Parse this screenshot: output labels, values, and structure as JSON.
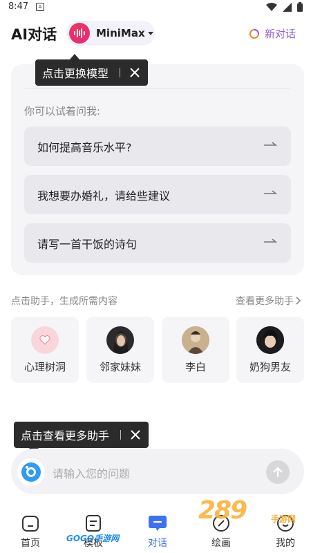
{
  "status_bar": {
    "time": "8:47",
    "notify_glyph": "A"
  },
  "header": {
    "title": "AI对话",
    "model_name": "MiniMax",
    "new_chat_label": "新对话"
  },
  "tooltips": {
    "switch_model": "点击更换模型",
    "more_assistants": "点击查看更多助手"
  },
  "suggestions": {
    "prompt": "你可以试着问我:",
    "items": [
      {
        "text": "如何提高音乐水平?"
      },
      {
        "text": "我想要办婚礼，请给些建议"
      },
      {
        "text": "请写一首干饭的诗句"
      }
    ]
  },
  "assistants": {
    "hint": "点击助手，生成所需内容",
    "more_label": "查看更多助手",
    "items": [
      {
        "name": "心理树洞",
        "avatar": "heart-icon"
      },
      {
        "name": "邻家妹妹",
        "avatar": "girl-portrait"
      },
      {
        "name": "李白",
        "avatar": "poet-portrait"
      },
      {
        "name": "奶狗男友",
        "avatar": "boy-portrait"
      }
    ]
  },
  "input": {
    "placeholder": "请输入您的问题"
  },
  "bottom_nav": {
    "items": [
      {
        "label": "首页",
        "icon": "home-icon"
      },
      {
        "label": "模板",
        "icon": "template-icon"
      },
      {
        "label": "对话",
        "icon": "chat-icon",
        "active": true
      },
      {
        "label": "绘画",
        "icon": "brush-icon"
      },
      {
        "label": "我的",
        "icon": "profile-icon"
      }
    ]
  },
  "watermarks": {
    "left": "GOGO手游网",
    "right": "289",
    "right_sub": "手游网"
  },
  "colors": {
    "accent": "#3c71f2",
    "new_chat": "#8f5bd9",
    "model_logo": "#f0355e",
    "watermark": "#fbb23b"
  }
}
